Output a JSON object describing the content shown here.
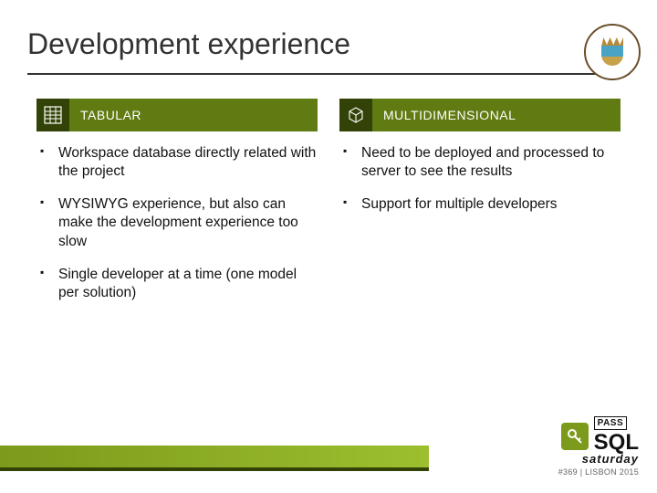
{
  "title": "Development experience",
  "columns": {
    "left": {
      "heading": "TABULAR",
      "icon": "spreadsheet-icon",
      "items": [
        "Workspace database directly related with the project",
        "WYSIWYG experience, but also can make the development experience too slow",
        "Single developer at a time (one model per solution)"
      ]
    },
    "right": {
      "heading": "MULTIDIMENSIONAL",
      "icon": "cube-icon",
      "items": [
        "Need to be deployed and processed to server to see the results",
        "Support for multiple developers"
      ]
    }
  },
  "footer": {
    "brand_top": "PASS",
    "brand_main": "SQL",
    "brand_sub": "saturday",
    "event": "#369 | LISBON 2015"
  }
}
